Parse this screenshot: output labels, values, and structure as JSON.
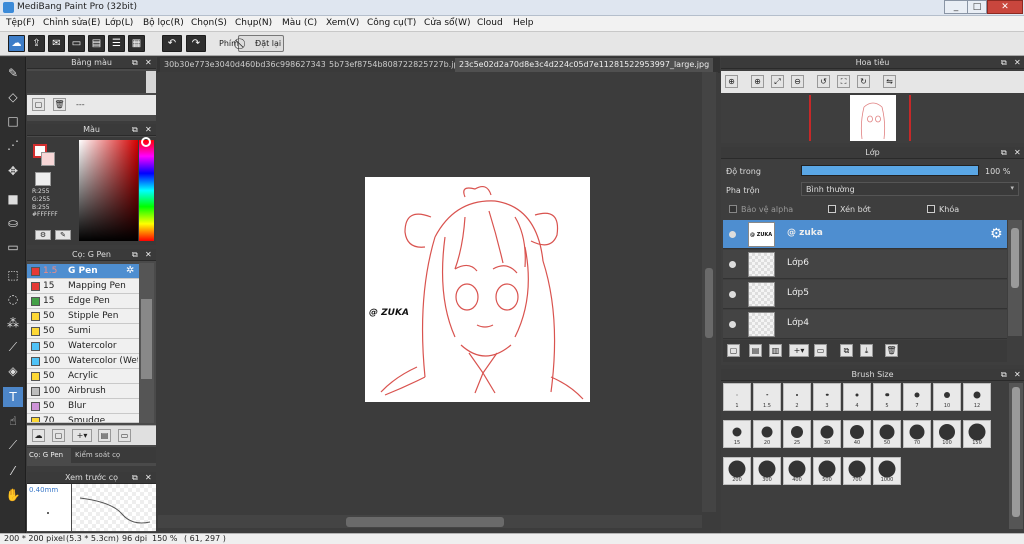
{
  "window": {
    "title": "MediBang Paint Pro (32bit)",
    "min": "_",
    "max": "□",
    "close": "✕"
  },
  "menu": [
    "Tệp(F)",
    "Chỉnh sửa(E)",
    "Lớp(L)",
    "Bộ lọc(R)",
    "Chọn(S)",
    "Chụp(N)",
    "Màu (C)",
    "Xem(V)",
    "Công cụ(T)",
    "Cửa sổ(W)",
    "Cloud",
    "Help"
  ],
  "toolbar": {
    "shortcut_label": "Phím",
    "reset_label": "Đặt lại"
  },
  "brush_colors_panel": {
    "title": "Bảng màu",
    "dash": "---"
  },
  "color_panel": {
    "title": "Màu",
    "r": "R:255",
    "g": "G:255",
    "b": "B:255",
    "hex": "#FFFFFF",
    "primary": "#d32f2f"
  },
  "brush_panel": {
    "title": "Cọ: G Pen",
    "items": [
      {
        "size": "1.5",
        "name": "G Pen",
        "color": "#e53935"
      },
      {
        "size": "15",
        "name": "Mapping Pen",
        "color": "#e53935"
      },
      {
        "size": "15",
        "name": "Edge Pen",
        "color": "#43a047"
      },
      {
        "size": "50",
        "name": "Stipple Pen",
        "color": "#fdd835"
      },
      {
        "size": "50",
        "name": "Sumi",
        "color": "#fdd835"
      },
      {
        "size": "50",
        "name": "Watercolor",
        "color": "#4fc3f7"
      },
      {
        "size": "100",
        "name": "Watercolor (Wet",
        "color": "#4fc3f7"
      },
      {
        "size": "50",
        "name": "Acrylic",
        "color": "#fdd835"
      },
      {
        "size": "100",
        "name": "Airbrush",
        "color": "#bdbdbd"
      },
      {
        "size": "50",
        "name": "Blur",
        "color": "#ce93d8"
      },
      {
        "size": "70",
        "name": "Smudge",
        "color": "#fdd835"
      }
    ],
    "tab_brush": "Cọ: G Pen",
    "tab_control": "Kiểm soát cọ"
  },
  "preview_panel": {
    "title": "Xem trước cọ",
    "size": "0.40mm"
  },
  "tabs": [
    "30b30e773e3040d460bd36c998627343.jpg",
    "5b73ef8754b808722825727b.jpg",
    "23c5e02d2a70d8e3c4d224c05d7e11281522953997_large.jpg"
  ],
  "canvas": {
    "watermark": "@ ZUKA"
  },
  "navigator": {
    "title": "Hoa tiêu"
  },
  "layer_panel": {
    "title": "Lớp",
    "opacity_label": "Độ trong",
    "opacity_value": "100 %",
    "opacity": 1.0,
    "blend_label": "Pha trộn",
    "blend_value": "Bình thường",
    "protect_alpha": "Bảo vệ alpha",
    "clipping": "Xén bớt",
    "lock": "Khóa",
    "layers": [
      {
        "name": "@ zuka",
        "thumb_text": "@ ZUKA"
      },
      {
        "name": "Lớp6"
      },
      {
        "name": "Lớp5"
      },
      {
        "name": "Lớp4"
      }
    ]
  },
  "brush_size_panel": {
    "title": "Brush Size",
    "sizes": [
      "1",
      "1.5",
      "2",
      "3",
      "4",
      "5",
      "7",
      "10",
      "12",
      "15",
      "20",
      "25",
      "30",
      "40",
      "50",
      "70",
      "100",
      "150",
      "200",
      "300",
      "400",
      "500",
      "700",
      "1000"
    ]
  },
  "status": {
    "dimensions": "200 * 200 pixel",
    "physical": "(5.3 * 5.3cm)",
    "dpi": "96 dpi",
    "zoom": "150 %",
    "cursor": "( 61, 297 )"
  }
}
